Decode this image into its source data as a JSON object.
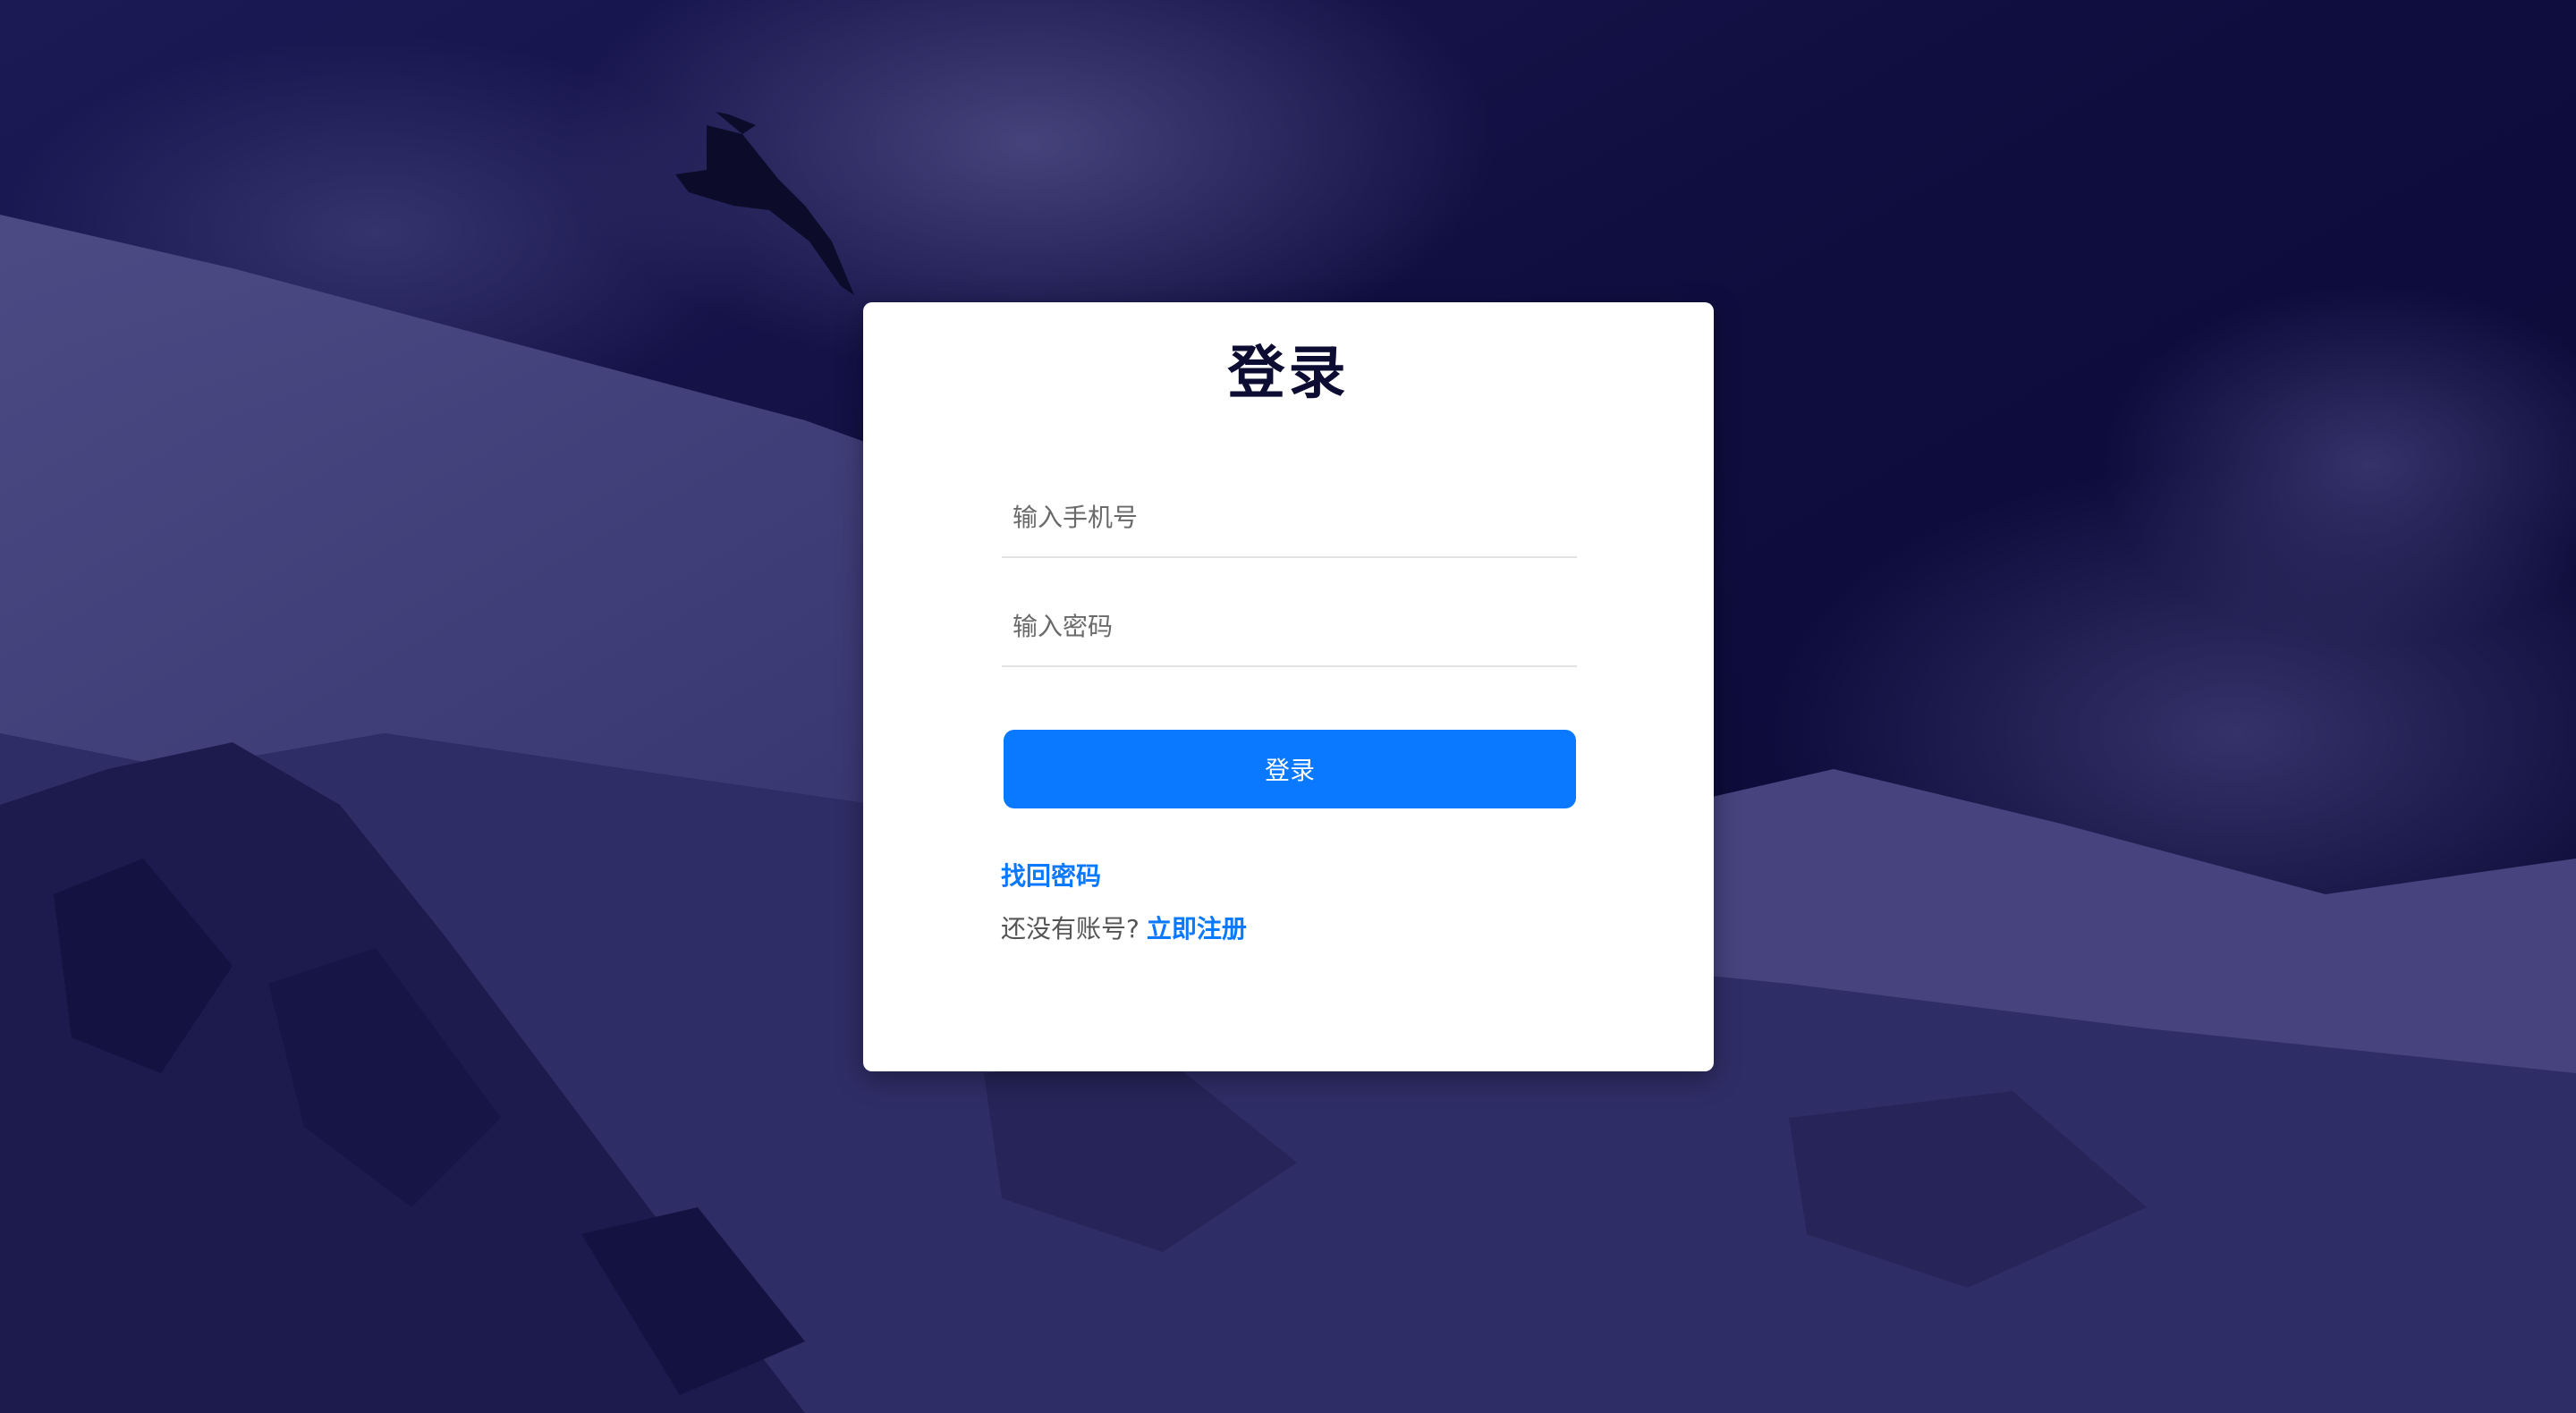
{
  "login_card": {
    "title": "登录",
    "phone_placeholder": "输入手机号",
    "password_placeholder": "输入密码",
    "submit_label": "登录",
    "forgot_password_link": "找回密码",
    "signup_prompt": "还没有账号?",
    "signup_link": "立即注册"
  },
  "colors": {
    "background_overlay": "#0b0a36",
    "accent": "#0a78ff",
    "title_text": "#0d0d33"
  }
}
